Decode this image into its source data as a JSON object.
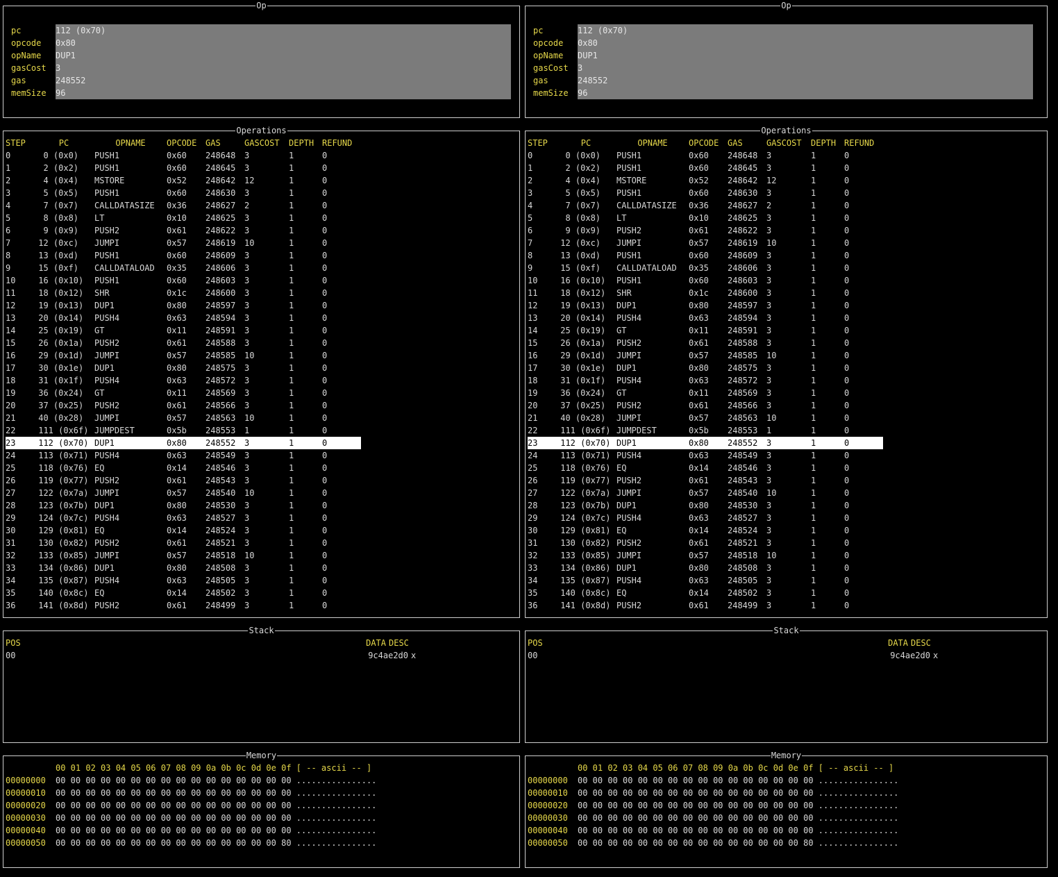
{
  "panel_titles": {
    "op": "Op",
    "operations": "Operations",
    "stack": "Stack",
    "memory": "Memory"
  },
  "op": [
    [
      "pc",
      "112 (0x70)"
    ],
    [
      "opcode",
      "0x80"
    ],
    [
      "opName",
      "DUP1"
    ],
    [
      "gasCost",
      "3"
    ],
    [
      "gas",
      "248552"
    ],
    [
      "memSize",
      "96"
    ]
  ],
  "operations_header": [
    "STEP",
    "PC",
    "OPNAME",
    "OPCODE",
    "GAS",
    "GASCOST",
    "DEPTH",
    "REFUND"
  ],
  "operations_selected_step": "23",
  "operations": [
    [
      "0",
      "  0 (0x0)",
      "PUSH1",
      "0x60",
      "248648",
      "3",
      "1",
      "0"
    ],
    [
      "1",
      "  2 (0x2)",
      "PUSH1",
      "0x60",
      "248645",
      "3",
      "1",
      "0"
    ],
    [
      "2",
      "  4 (0x4)",
      "MSTORE",
      "0x52",
      "248642",
      "12",
      "1",
      "0"
    ],
    [
      "3",
      "  5 (0x5)",
      "PUSH1",
      "0x60",
      "248630",
      "3",
      "1",
      "0"
    ],
    [
      "4",
      "  7 (0x7)",
      "CALLDATASIZE",
      "0x36",
      "248627",
      "2",
      "1",
      "0"
    ],
    [
      "5",
      "  8 (0x8)",
      "LT",
      "0x10",
      "248625",
      "3",
      "1",
      "0"
    ],
    [
      "6",
      "  9 (0x9)",
      "PUSH2",
      "0x61",
      "248622",
      "3",
      "1",
      "0"
    ],
    [
      "7",
      " 12 (0xc)",
      "JUMPI",
      "0x57",
      "248619",
      "10",
      "1",
      "0"
    ],
    [
      "8",
      " 13 (0xd)",
      "PUSH1",
      "0x60",
      "248609",
      "3",
      "1",
      "0"
    ],
    [
      "9",
      " 15 (0xf)",
      "CALLDATALOAD",
      "0x35",
      "248606",
      "3",
      "1",
      "0"
    ],
    [
      "10",
      " 16 (0x10)",
      "PUSH1",
      "0x60",
      "248603",
      "3",
      "1",
      "0"
    ],
    [
      "11",
      " 18 (0x12)",
      "SHR",
      "0x1c",
      "248600",
      "3",
      "1",
      "0"
    ],
    [
      "12",
      " 19 (0x13)",
      "DUP1",
      "0x80",
      "248597",
      "3",
      "1",
      "0"
    ],
    [
      "13",
      " 20 (0x14)",
      "PUSH4",
      "0x63",
      "248594",
      "3",
      "1",
      "0"
    ],
    [
      "14",
      " 25 (0x19)",
      "GT",
      "0x11",
      "248591",
      "3",
      "1",
      "0"
    ],
    [
      "15",
      " 26 (0x1a)",
      "PUSH2",
      "0x61",
      "248588",
      "3",
      "1",
      "0"
    ],
    [
      "16",
      " 29 (0x1d)",
      "JUMPI",
      "0x57",
      "248585",
      "10",
      "1",
      "0"
    ],
    [
      "17",
      " 30 (0x1e)",
      "DUP1",
      "0x80",
      "248575",
      "3",
      "1",
      "0"
    ],
    [
      "18",
      " 31 (0x1f)",
      "PUSH4",
      "0x63",
      "248572",
      "3",
      "1",
      "0"
    ],
    [
      "19",
      " 36 (0x24)",
      "GT",
      "0x11",
      "248569",
      "3",
      "1",
      "0"
    ],
    [
      "20",
      " 37 (0x25)",
      "PUSH2",
      "0x61",
      "248566",
      "3",
      "1",
      "0"
    ],
    [
      "21",
      " 40 (0x28)",
      "JUMPI",
      "0x57",
      "248563",
      "10",
      "1",
      "0"
    ],
    [
      "22",
      " 111 (0x6f)",
      "JUMPDEST",
      "0x5b",
      "248553",
      "1",
      "1",
      "0"
    ],
    [
      "23",
      " 112 (0x70)",
      "DUP1",
      "0x80",
      "248552",
      "3",
      "1",
      "0"
    ],
    [
      "24",
      " 113 (0x71)",
      "PUSH4",
      "0x63",
      "248549",
      "3",
      "1",
      "0"
    ],
    [
      "25",
      " 118 (0x76)",
      "EQ",
      "0x14",
      "248546",
      "3",
      "1",
      "0"
    ],
    [
      "26",
      " 119 (0x77)",
      "PUSH2",
      "0x61",
      "248543",
      "3",
      "1",
      "0"
    ],
    [
      "27",
      " 122 (0x7a)",
      "JUMPI",
      "0x57",
      "248540",
      "10",
      "1",
      "0"
    ],
    [
      "28",
      " 123 (0x7b)",
      "DUP1",
      "0x80",
      "248530",
      "3",
      "1",
      "0"
    ],
    [
      "29",
      " 124 (0x7c)",
      "PUSH4",
      "0x63",
      "248527",
      "3",
      "1",
      "0"
    ],
    [
      "30",
      " 129 (0x81)",
      "EQ",
      "0x14",
      "248524",
      "3",
      "1",
      "0"
    ],
    [
      "31",
      " 130 (0x82)",
      "PUSH2",
      "0x61",
      "248521",
      "3",
      "1",
      "0"
    ],
    [
      "32",
      " 133 (0x85)",
      "JUMPI",
      "0x57",
      "248518",
      "10",
      "1",
      "0"
    ],
    [
      "33",
      " 134 (0x86)",
      "DUP1",
      "0x80",
      "248508",
      "3",
      "1",
      "0"
    ],
    [
      "34",
      " 135 (0x87)",
      "PUSH4",
      "0x63",
      "248505",
      "3",
      "1",
      "0"
    ],
    [
      "35",
      " 140 (0x8c)",
      "EQ",
      "0x14",
      "248502",
      "3",
      "1",
      "0"
    ],
    [
      "36",
      " 141 (0x8d)",
      "PUSH2",
      "0x61",
      "248499",
      "3",
      "1",
      "0"
    ]
  ],
  "stack_header": {
    "pos": "POS",
    "data": "DATA",
    "desc": "DESC"
  },
  "stack": [
    {
      "pos": "00",
      "data": "9c4ae2d0",
      "desc": "x"
    }
  ],
  "memory_header": {
    "addr": "",
    "bytes": "00 01 02 03 04 05 06 07 08 09 0a 0b 0c 0d 0e 0f",
    "ascii": "[ -- ascii -- ]"
  },
  "memory": [
    {
      "addr": "00000000",
      "bytes": "00 00 00 00 00 00 00 00 00 00 00 00 00 00 00 00",
      "ascii": "................"
    },
    {
      "addr": "00000010",
      "bytes": "00 00 00 00 00 00 00 00 00 00 00 00 00 00 00 00",
      "ascii": "................"
    },
    {
      "addr": "00000020",
      "bytes": "00 00 00 00 00 00 00 00 00 00 00 00 00 00 00 00",
      "ascii": "................"
    },
    {
      "addr": "00000030",
      "bytes": "00 00 00 00 00 00 00 00 00 00 00 00 00 00 00 00",
      "ascii": "................"
    },
    {
      "addr": "00000040",
      "bytes": "00 00 00 00 00 00 00 00 00 00 00 00 00 00 00 00",
      "ascii": "................"
    },
    {
      "addr": "00000050",
      "bytes": "00 00 00 00 00 00 00 00 00 00 00 00 00 00 00 80",
      "ascii": "................"
    }
  ],
  "colors": {
    "label": "#e6d84a",
    "text": "#d8d8d8",
    "background": "#000000",
    "op_value_bg": "#7b7b7b",
    "selected_bg": "#ffffff"
  }
}
